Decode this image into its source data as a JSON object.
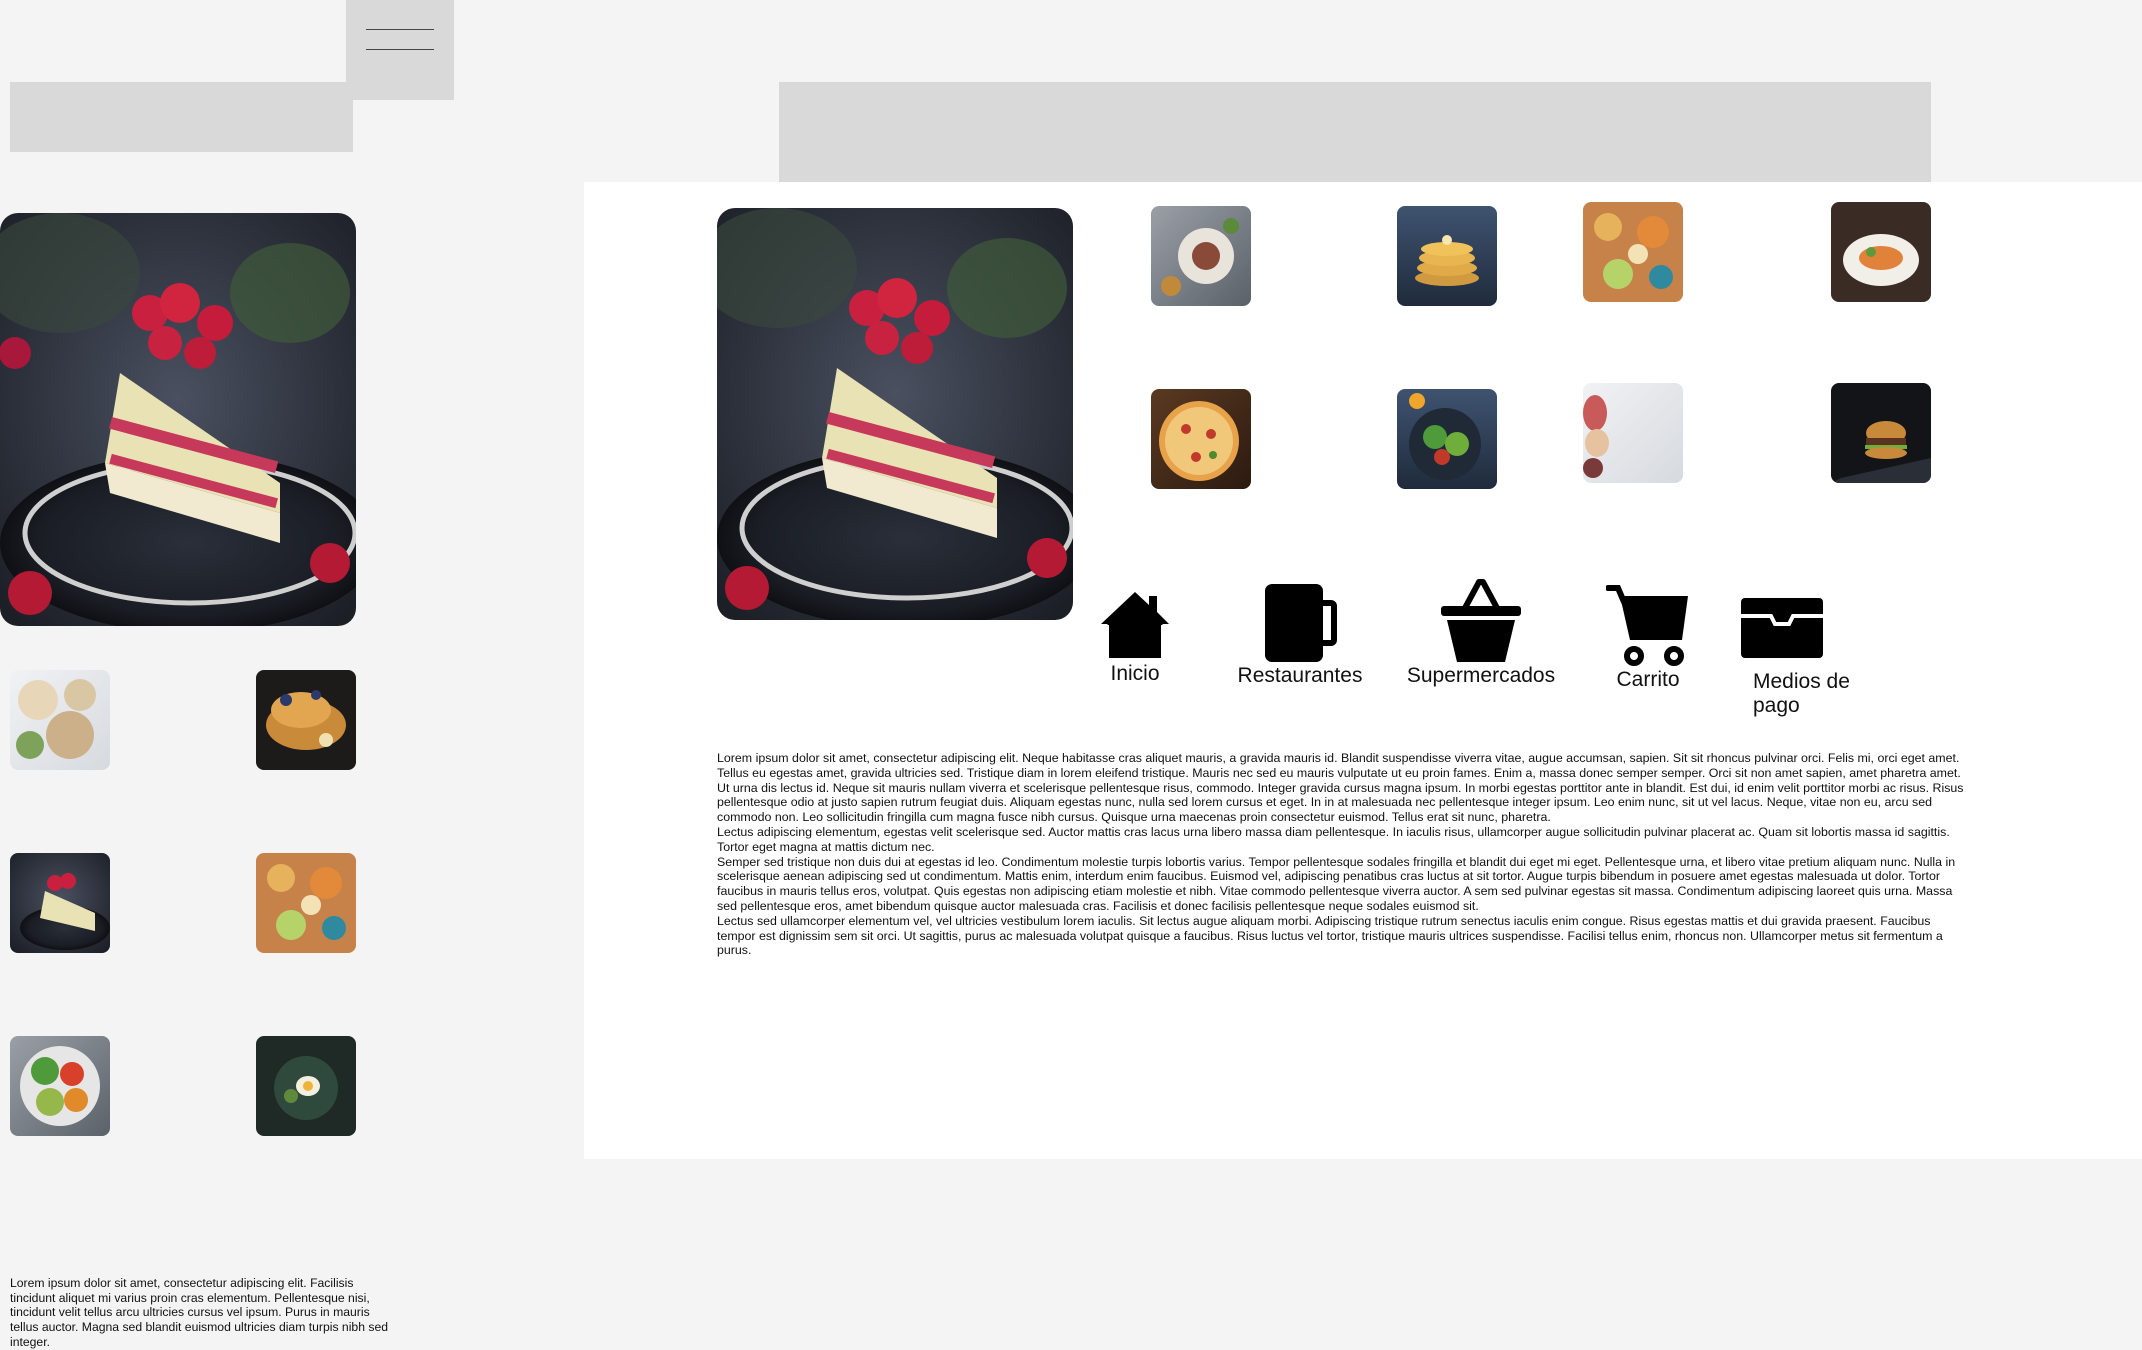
{
  "header": {
    "menu_icon": "hamburger-menu-icon"
  },
  "hero_image": {
    "subject": "layered raspberry cake slice on dark plate"
  },
  "left_gallery": [
    "breakfast table spread",
    "french toast with blueberries",
    "raspberry cake slice",
    "fruit and snack platter",
    "fresh salad bowl",
    "dark bowl with egg and greens"
  ],
  "food_grid": [
    "plated dishes with herbs",
    "pancake stack",
    "fruit and snack platter",
    "salmon dish on plate",
    "pizza on wooden board",
    "green salad bowl",
    "charcuterie on white",
    "burger on dark background"
  ],
  "nav": {
    "items": [
      {
        "label": "Inicio",
        "icon": "home-icon"
      },
      {
        "label": "Restaurantes",
        "icon": "mug-icon"
      },
      {
        "label": "Supermercados",
        "icon": "basket-icon"
      },
      {
        "label": "Carrito",
        "icon": "cart-icon"
      },
      {
        "label": "Medios de pago",
        "icon": "wallet-icon"
      }
    ]
  },
  "main_text": {
    "paragraphs": [
      "Lorem ipsum dolor sit amet, consectetur adipiscing elit. Neque habitasse cras aliquet mauris, a gravida mauris id. Blandit suspendisse viverra vitae, augue accumsan, sapien. Sit sit rhoncus pulvinar orci. Felis mi, orci eget amet. Tellus eu egestas amet, gravida ultricies sed. Tristique diam in lorem eleifend tristique. Mauris nec sed eu mauris vulputate ut eu proin fames. Enim a, massa donec semper semper. Orci sit non amet sapien, amet pharetra amet.",
      "Ut urna dis lectus id. Neque sit mauris nullam viverra et scelerisque pellentesque risus, commodo. Integer gravida cursus magna ipsum. In morbi egestas porttitor ante in blandit. Est dui, id enim velit porttitor morbi ac risus. Risus pellentesque odio at justo sapien rutrum feugiat duis. Aliquam egestas nunc, nulla sed lorem cursus et eget. In in at malesuada nec pellentesque integer ipsum. Leo enim nunc, sit ut vel lacus. Neque, vitae non eu, arcu sed commodo non. Leo sollicitudin fringilla cum magna fusce nibh cursus. Quisque urna maecenas proin consectetur euismod. Tellus erat sit nunc, pharetra.",
      "Lectus adipiscing elementum, egestas velit scelerisque sed. Auctor mattis cras lacus urna libero massa diam pellentesque. In iaculis risus, ullamcorper augue sollicitudin pulvinar placerat ac. Quam sit lobortis massa id sagittis. Tortor eget magna at mattis dictum nec.",
      "Semper sed tristique non duis dui at egestas id leo. Condimentum molestie turpis lobortis varius. Tempor pellentesque sodales fringilla et blandit dui eget mi eget. Pellentesque urna, et libero vitae pretium aliquam nunc. Nulla in scelerisque aenean adipiscing sed ut condimentum. Mattis enim, interdum enim faucibus. Euismod vel, adipiscing penatibus cras luctus at sit tortor. Augue turpis bibendum in posuere amet egestas malesuada ut dolor. Tortor faucibus in mauris tellus eros, volutpat. Quis egestas non adipiscing etiam molestie et nibh. Vitae commodo pellentesque viverra auctor. A sem sed pulvinar egestas sit massa. Condimentum adipiscing laoreet quis urna. Massa sed pellentesque eros, amet bibendum quisque auctor malesuada cras. Facilisis et donec facilisis pellentesque neque sodales euismod sit.",
      "Lectus sed ullamcorper elementum vel, vel ultricies vestibulum lorem iaculis. Sit lectus augue aliquam morbi. Adipiscing tristique rutrum senectus iaculis enim congue. Risus egestas mattis et dui gravida praesent. Faucibus tempor est dignissim sem sit orci. Ut sagittis, purus ac malesuada volutpat quisque a faucibus. Risus luctus vel tortor, tristique mauris ultrices suspendisse. Facilisi tellus enim, rhoncus non. Ullamcorper metus sit fermentum a purus."
    ]
  },
  "left_text": "Lorem ipsum dolor sit amet, consectetur adipiscing elit. Facilisis tincidunt aliquet mi varius proin cras elementum. Pellentesque nisi, tincidunt velit tellus arcu ultricies cursus vel ipsum. Purus in mauris tellus auctor. Magna sed blandit euismod ultricies diam turpis nibh sed integer.",
  "colors": {
    "page_background": "#f4f4f4",
    "placeholder_gray": "#d9d9d9",
    "panel_white": "#ffffff",
    "icon_black": "#000000"
  }
}
